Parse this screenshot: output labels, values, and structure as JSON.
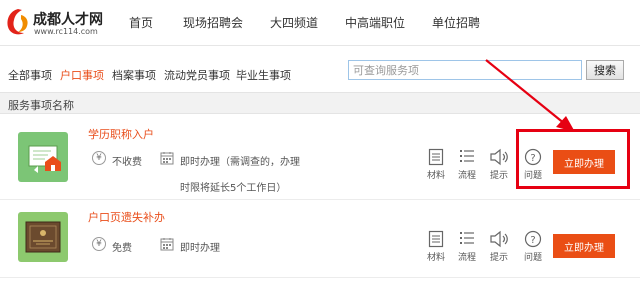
{
  "brand": {
    "title": "成都人才网",
    "url": "www.rc114.com"
  },
  "nav": {
    "items": [
      {
        "label": "首页"
      },
      {
        "label": "现场招聘会"
      },
      {
        "label": "大四频道"
      },
      {
        "label": "中高端职位"
      },
      {
        "label": "单位招聘"
      }
    ]
  },
  "categories": {
    "items": [
      {
        "label": "全部事项",
        "active": false
      },
      {
        "label": "户口事项",
        "active": true
      },
      {
        "label": "档案事项",
        "active": false
      },
      {
        "label": "流动党员事项",
        "active": false
      },
      {
        "label": "毕业生事项",
        "active": false
      }
    ]
  },
  "search": {
    "placeholder": "可查询服务项",
    "value": "",
    "button_label": "搜索"
  },
  "list": {
    "header": "服务事项名称",
    "rows": [
      {
        "title": "学历职称入户",
        "fee_icon": "yen-icon",
        "fee": "不收费",
        "time": "即时办理（需调查的，办理",
        "time_note": "时限将延长5个工作日）",
        "actions": [
          "材料",
          "流程",
          "提示",
          "问题"
        ],
        "apply_label": "立即办理"
      },
      {
        "title": "户口页遗失补办",
        "fee_icon": "yen-icon",
        "fee": "免费",
        "time": "即时办理",
        "actions": [
          "材料",
          "流程",
          "提示",
          "问题"
        ],
        "apply_label": "立即办理"
      }
    ]
  },
  "icons": {
    "fee": "¥",
    "question": "?"
  },
  "colors": {
    "accent": "#ea4e15",
    "active_tab": "#e94e1b",
    "annotation": "#e60012",
    "thumb_green": "#7cc576"
  }
}
